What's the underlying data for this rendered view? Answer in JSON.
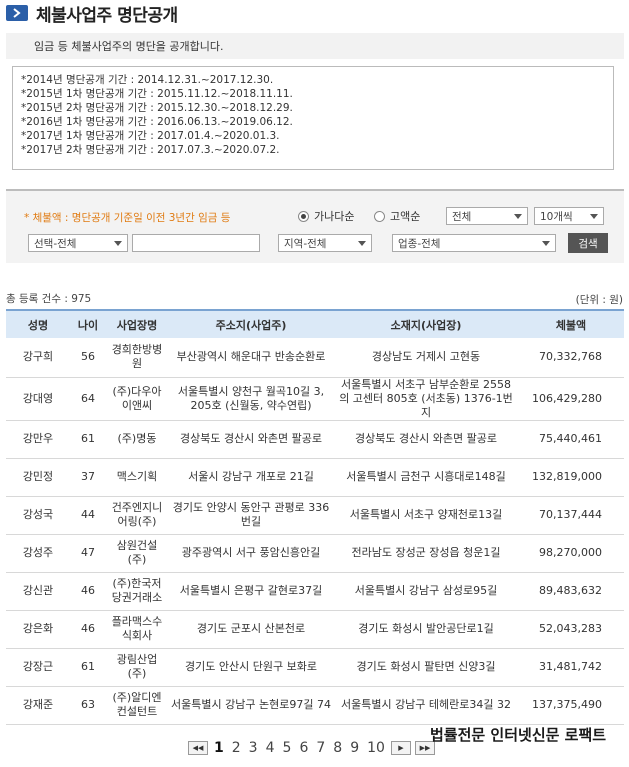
{
  "header": {
    "title": "체불사업주 명단공개"
  },
  "intro": "임금 등 체불사업주의 명단을 공개합니다.",
  "notice_lines": [
    "*2014년 명단공개 기간 : 2014.12.31.~2017.12.30.",
    "*2015년 1차 명단공개 기간 : 2015.11.12.~2018.11.11.",
    "*2015년 2차 명단공개 기간 : 2015.12.30.~2018.12.29.",
    "*2016년 1차 명단공개 기간 : 2016.06.13.~2019.06.12.",
    "*2017년 1차 명단공개 기간 : 2017.01.4.~2020.01.3.",
    "*2017년 2차 명단공개 기간 : 2017.07.3.~2020.07.2."
  ],
  "search": {
    "note": "* 체불액 : 명단공개 기준일 이전 3년간 임금 등",
    "sort_options": [
      "가나다순",
      "고액순"
    ],
    "sort_selected": "가나다순",
    "scope_select": "전체",
    "per_page_select": "10개씩",
    "field_select": "선택-전체",
    "keyword_value": "",
    "region_select": "지역-전체",
    "industry_select": "업종-전체",
    "search_button": "검색"
  },
  "count_label": "총 등록 건수 : 975",
  "unit_label": "(단위 : 원)",
  "table": {
    "headers": [
      "성명",
      "나이",
      "사업장명",
      "주소지(사업주)",
      "소재지(사업장)",
      "체불액"
    ],
    "rows": [
      [
        "강구희",
        "56",
        "경희한방병원",
        "부산광역시 해운대구 반송순환로",
        "경상남도 거제시 고현동",
        "70,332,768"
      ],
      [
        "강대영",
        "64",
        "(주)다우아이앤씨",
        "서울특별시 양천구 월곡10길 3, 205호 (신월동, 약수연립)",
        "서울특별시 서초구 남부순환로 2558의 고센터 805호 (서초동) 1376-1번지",
        "106,429,280"
      ],
      [
        "강만우",
        "61",
        "(주)명동",
        "경상북도 경산시 와촌면 팔공로",
        "경상북도 경산시 와촌면 팔공로",
        "75,440,461"
      ],
      [
        "강민정",
        "37",
        "맥스기획",
        "서울시 강남구 개포로 21길",
        "서울특별시 금천구 시흥대로148길",
        "132,819,000"
      ],
      [
        "강성국",
        "44",
        "건주엔지니어링(주)",
        "경기도 안양시 동안구 관평로 336번길",
        "서울특별시 서초구 양재천로13길",
        "70,137,444"
      ],
      [
        "강성주",
        "47",
        "삼원건설(주)",
        "광주광역시 서구 풍암신흥안길",
        "전라남도 장성군 장성읍 청운1길",
        "98,270,000"
      ],
      [
        "강신관",
        "46",
        "(주)한국저당권거래소",
        "서울특별시 은평구 갈현로37길",
        "서울특별시 강남구 삼성로95길",
        "89,483,632"
      ],
      [
        "강은화",
        "46",
        "플라맥스수식회사",
        "경기도 군포시 산본천로",
        "경기도 화성시 발안공단로1길",
        "52,043,283"
      ],
      [
        "강장근",
        "61",
        "광림산업(주)",
        "경기도 안산시 단원구 보화로",
        "경기도 화성시 팔탄면 신양3길",
        "31,481,742"
      ],
      [
        "강재준",
        "63",
        "(주)알디엔컨설턴트",
        "서울특별시 강남구 논현로97길 74",
        "서울특별시 강남구 테헤란로34길 32",
        "137,375,490"
      ]
    ]
  },
  "pager": {
    "first": "◀◀",
    "prev": "◀",
    "pages": [
      "1",
      "2",
      "3",
      "4",
      "5",
      "6",
      "7",
      "8",
      "9",
      "10"
    ],
    "current": "1",
    "next": "▶",
    "last": "▶▶"
  },
  "watermark": "법률전문 인터넷신문 로팩트",
  "colors": {
    "header_icon": "#2b5fa8",
    "note_orange": "#e07b12",
    "table_head": "#dbe9f7"
  }
}
